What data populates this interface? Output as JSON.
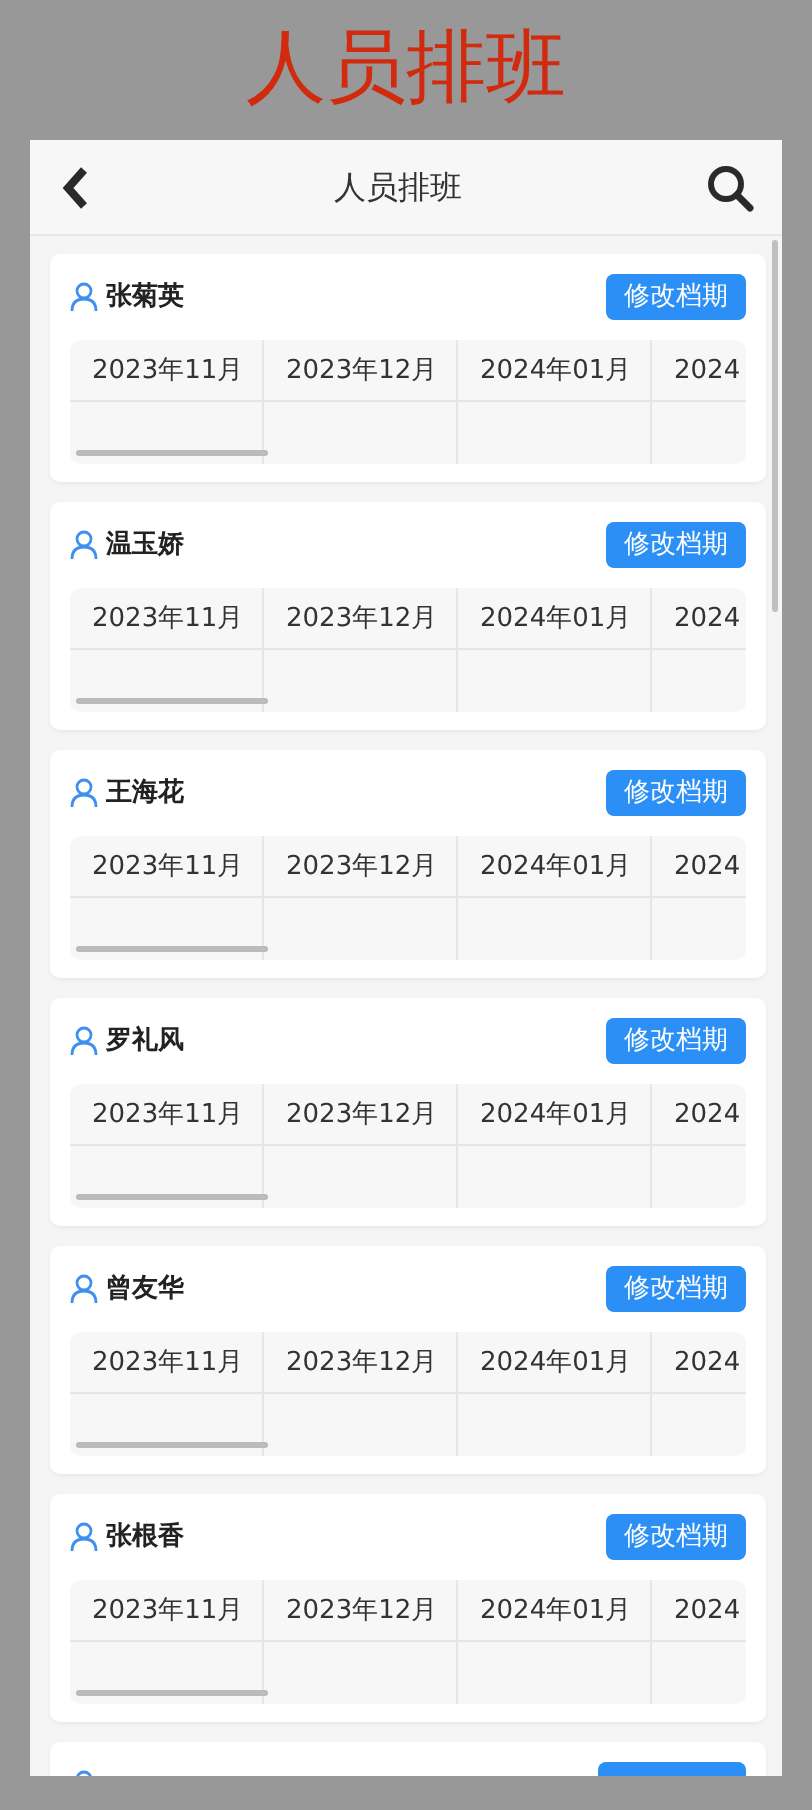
{
  "page_title": "人员排班",
  "header": {
    "title": "人员排班"
  },
  "staff": [
    {
      "kind": "full",
      "name": "张菊英",
      "button": "修改档期",
      "months": [
        "2023年11月",
        "2023年12月",
        "2024年01月",
        "2024"
      ]
    },
    {
      "kind": "full",
      "name": "温玉娇",
      "button": "修改档期",
      "months": [
        "2023年11月",
        "2023年12月",
        "2024年01月",
        "2024"
      ]
    },
    {
      "kind": "full",
      "name": "王海花",
      "button": "修改档期",
      "months": [
        "2023年11月",
        "2023年12月",
        "2024年01月",
        "2024"
      ]
    },
    {
      "kind": "full",
      "name": "罗礼风",
      "button": "修改档期",
      "months": [
        "2023年11月",
        "2023年12月",
        "2024年01月",
        "2024"
      ]
    },
    {
      "kind": "full",
      "name": "曾友华",
      "button": "修改档期",
      "months": [
        "2023年11月",
        "2023年12月",
        "2024年01月",
        "2024"
      ]
    },
    {
      "kind": "full",
      "name": "张根香",
      "button": "修改档期",
      "months": [
        "2023年11月",
        "2023年12月",
        "2024年01月",
        "2024"
      ]
    },
    {
      "kind": "cut"
    }
  ]
}
